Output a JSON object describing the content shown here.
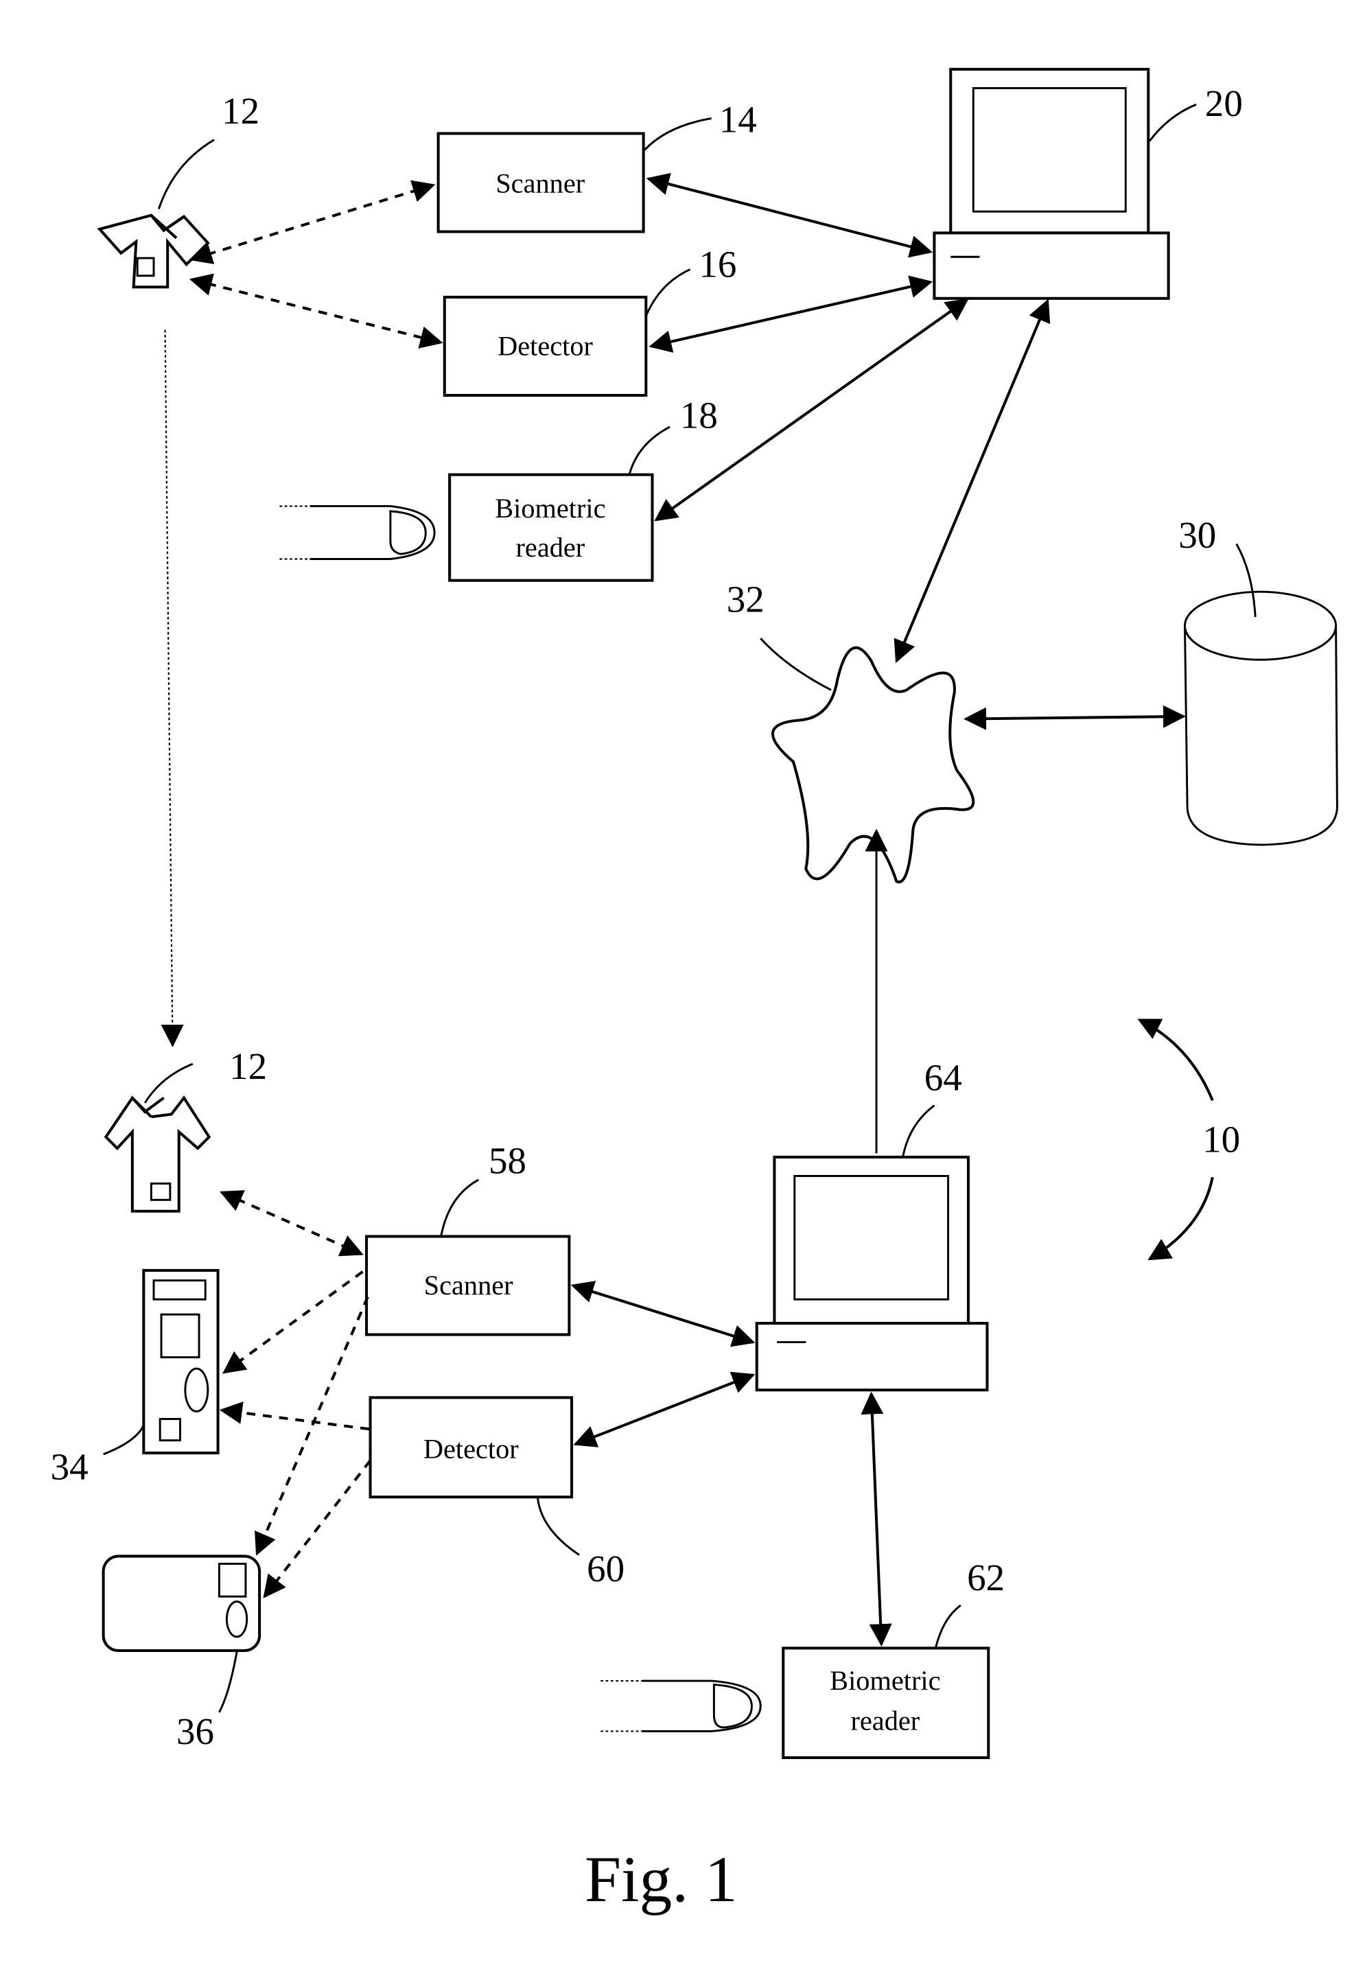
{
  "figure": {
    "caption": "Fig. 1",
    "system_ref": "10"
  },
  "top_station": {
    "garment": {
      "ref": "12"
    },
    "scanner": {
      "label": "Scanner",
      "ref": "14"
    },
    "detector": {
      "label": "Detector",
      "ref": "16"
    },
    "biometric_reader": {
      "label_line1": "Biometric",
      "label_line2": "reader",
      "ref": "18"
    },
    "computer": {
      "ref": "20"
    }
  },
  "network": {
    "ref": "32"
  },
  "database": {
    "ref": "30"
  },
  "bottom_station": {
    "garment": {
      "ref": "12"
    },
    "device_tall": {
      "ref": "34"
    },
    "device_card": {
      "ref": "36"
    },
    "scanner": {
      "label": "Scanner",
      "ref": "58"
    },
    "detector": {
      "label": "Detector",
      "ref": "60"
    },
    "biometric_reader": {
      "label_line1": "Biometric",
      "label_line2": "reader",
      "ref": "62"
    },
    "computer": {
      "ref": "64"
    }
  }
}
